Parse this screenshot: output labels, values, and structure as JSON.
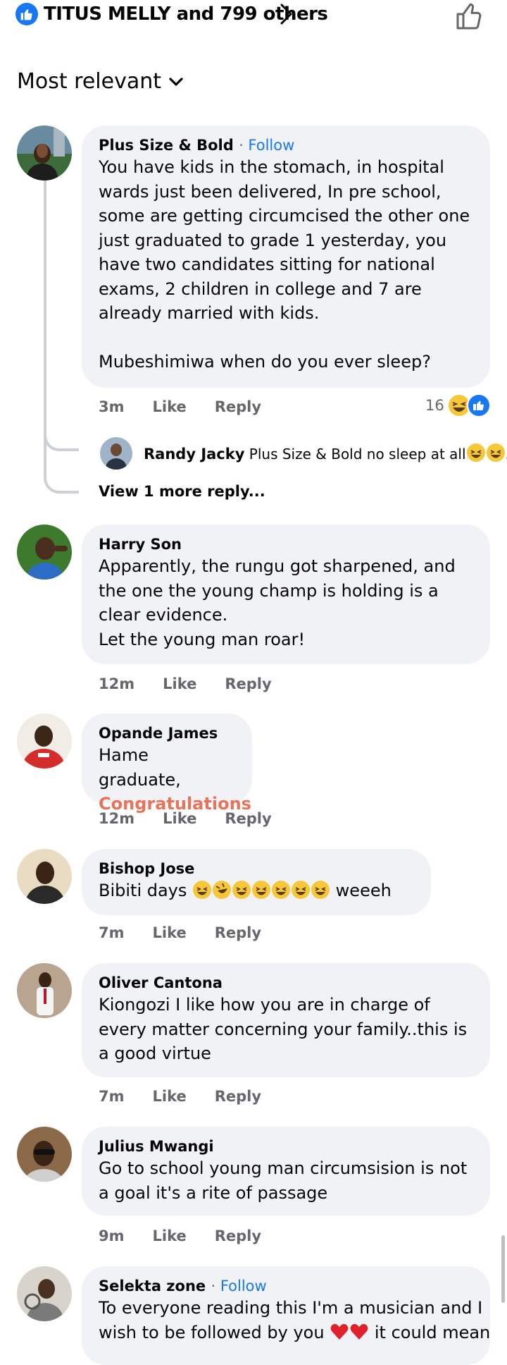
{
  "header": {
    "reactors": "TITUS MELLY and 799 others",
    "sort_label": "Most relevant"
  },
  "comments": [
    {
      "author": "Plus Size & Bold",
      "follow": "Follow",
      "text": "You have kids in the stomach, in hospital wards just been delivered, In pre school, some are getting circumcised the other one just graduated to grade 1 yesterday, you have two candidates sitting for national exams, 2 children in college and 7 are already married with kids.\n\nMubeshimiwa when do you ever sleep?",
      "time": "3m",
      "like": "Like",
      "reply": "Reply",
      "reaction_count": "16"
    },
    {
      "author": "Harry Son",
      "text": "Apparently, the rungu got sharpened, and the one the young champ is holding is a clear evidence.\nLet the young man roar!",
      "time": "12m",
      "like": "Like",
      "reply": "Reply"
    },
    {
      "author": "Opande James",
      "text": "Hame graduate,",
      "text_accent": "Congratulations",
      "time": "12m",
      "like": "Like",
      "reply": "Reply"
    },
    {
      "author": "Bishop Jose",
      "text": "Bibiti days",
      "text_after": "weeeh",
      "time": "7m",
      "like": "Like",
      "reply": "Reply"
    },
    {
      "author": "Oliver Cantona",
      "text": "Kiongozi I like how you are in charge of every matter concerning your family..this is a good virtue",
      "time": "7m",
      "like": "Like",
      "reply": "Reply"
    },
    {
      "author": "Julius Mwangi",
      "text": "Go to school young man circumsision is not a goal it's a rite of passage",
      "time": "9m",
      "like": "Like",
      "reply": "Reply"
    },
    {
      "author": "Selekta zone",
      "follow": "Follow",
      "text_line1": "To everyone reading this I'm a musician and I",
      "text_line2a": "wish to be followed by you",
      "text_line2b": "it could mean"
    }
  ],
  "reply_preview": {
    "author": "Randy Jacky",
    "text": "Plus Size & Bold no sleep at all",
    "ellipsis": "..."
  },
  "view_more": "View 1 more reply...",
  "colors": {
    "accent_blue": "#1877f2",
    "bubble": "#f0f2f5",
    "muted": "#65676b",
    "congrats": "#e8735a"
  }
}
